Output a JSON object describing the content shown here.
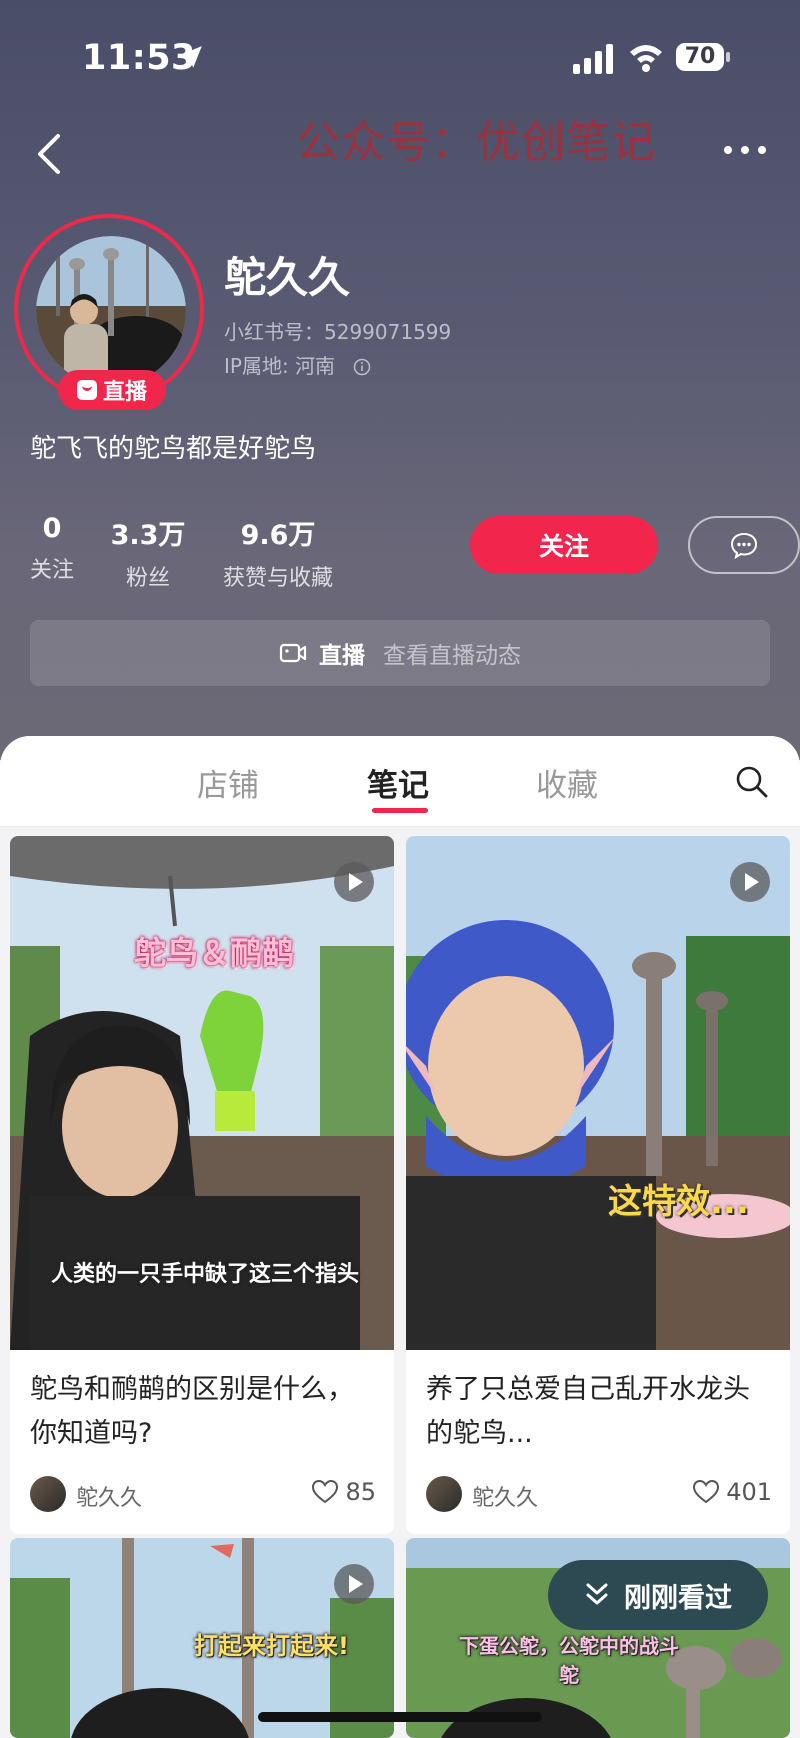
{
  "status_bar": {
    "time": "11:53",
    "battery": "70"
  },
  "watermark": "公众号：优创笔记",
  "profile": {
    "name": "鸵久久",
    "redbook_id": "小红书号：5299071599",
    "ip_location": "IP属地: 河南",
    "live_badge": "直播",
    "bio": "鸵飞飞的鸵鸟都是好鸵鸟",
    "stats": [
      {
        "value": "0",
        "label": "关注"
      },
      {
        "value": "3.3万",
        "label": "粉丝"
      },
      {
        "value": "9.6万",
        "label": "获赞与收藏"
      }
    ],
    "follow_label": "关注"
  },
  "live_bar": {
    "label": "直播",
    "sub": "查看直播动态"
  },
  "tabs": [
    {
      "label": "店铺",
      "active": false
    },
    {
      "label": "笔记",
      "active": true
    },
    {
      "label": "收藏",
      "active": false
    }
  ],
  "notes": [
    {
      "title": "鸵鸟和鸸鹋的区别是什么，你知道吗?",
      "author": "鸵久久",
      "likes": "85",
      "overlay_title": "鸵鸟＆鸸鹋",
      "overlay_sub": "人类的一只手中缺了这三个指头"
    },
    {
      "title": "养了只总爱自己乱开水龙头的鸵鸟...",
      "author": "鸵久久",
      "likes": "401",
      "overlay_title": "这特效..."
    },
    {
      "overlay_title": "打起来打起来!"
    },
    {
      "overlay_title": "下蛋公鸵，公鸵中的战斗鸵"
    }
  ],
  "recent_button": "刚刚看过",
  "colors": {
    "accent": "#f2264c",
    "header_bg": "#55566e"
  }
}
